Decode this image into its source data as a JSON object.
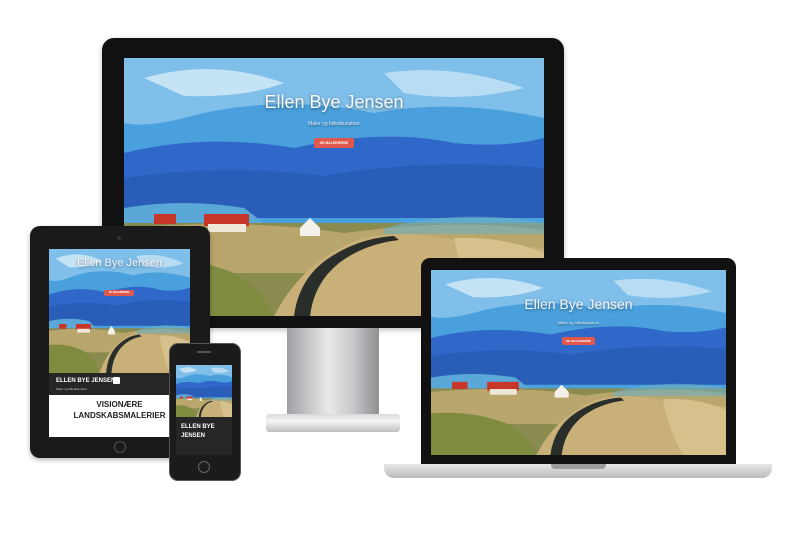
{
  "site": {
    "title": "Ellen Bye Jensen",
    "subtitle": "Maler og billedkunstner",
    "cta_label": "SE MALERIERNE"
  },
  "tablet": {
    "bar_title": "ELLEN BYE JENSEN",
    "bar_sub": "Maler og billedkunstner",
    "heading_line1": "VISIONÆRE",
    "heading_line2": "LANDSKABSMALERIER"
  },
  "phone": {
    "name_line1": "ELLEN BYE",
    "name_line2": "JENSEN"
  },
  "colors": {
    "sky": "#3a8fd4",
    "mountain": "#2f68c9",
    "hill": "#b6a36b",
    "road": "#2a2e2a",
    "button": "#e2574c",
    "roof": "#c8362a"
  }
}
